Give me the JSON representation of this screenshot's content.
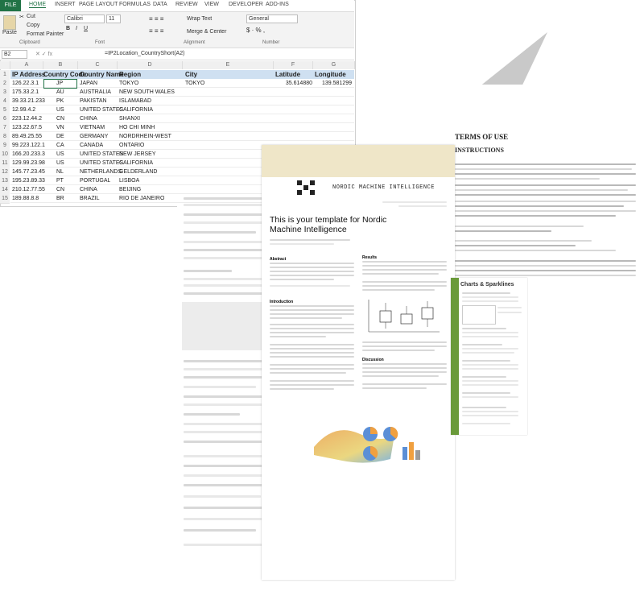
{
  "excel": {
    "ribbon_tabs": [
      "FILE",
      "HOME",
      "INSERT",
      "PAGE LAYOUT",
      "FORMULAS",
      "DATA",
      "REVIEW",
      "VIEW",
      "DEVELOPER",
      "ADD-INS"
    ],
    "clipboard": {
      "cut": "Cut",
      "copy": "Copy",
      "format_painter": "Format Painter",
      "paste": "Paste",
      "group": "Clipboard"
    },
    "font": {
      "name": "Calibri",
      "size": "11",
      "group": "Font"
    },
    "alignment": {
      "wrap": "Wrap Text",
      "merge": "Merge & Center",
      "group": "Alignment"
    },
    "number": {
      "format": "General",
      "group": "Number"
    },
    "name_box": "B2",
    "formula": "=IP2Location_CountryShort(A2)",
    "columns": [
      "A",
      "B",
      "C",
      "D",
      "E",
      "F",
      "G"
    ],
    "headers": [
      "IP Address",
      "Country Code",
      "Country Name",
      "Region",
      "City",
      "Latitude",
      "Longitude"
    ],
    "rows": [
      {
        "n": "2",
        "ip": "126.22.3.1",
        "cc": "JP",
        "country": "JAPAN",
        "region": "TOKYO",
        "city": "TOKYO",
        "lat": "35.614880",
        "lon": "139.581299"
      },
      {
        "n": "3",
        "ip": "175.33.2.1",
        "cc": "AU",
        "country": "AUSTRALIA",
        "region": "NEW SOUTH WALES",
        "city": "",
        "lat": "",
        "lon": ""
      },
      {
        "n": "4",
        "ip": "39.33.21.233",
        "cc": "PK",
        "country": "PAKISTAN",
        "region": "ISLAMABAD",
        "city": "",
        "lat": "",
        "lon": ""
      },
      {
        "n": "5",
        "ip": "12.99.4.2",
        "cc": "US",
        "country": "UNITED STATES",
        "region": "CALIFORNIA",
        "city": "",
        "lat": "",
        "lon": ""
      },
      {
        "n": "6",
        "ip": "223.12.44.2",
        "cc": "CN",
        "country": "CHINA",
        "region": "SHANXI",
        "city": "",
        "lat": "",
        "lon": ""
      },
      {
        "n": "7",
        "ip": "123.22.67.5",
        "cc": "VN",
        "country": "VIETNAM",
        "region": "HO CHI MINH",
        "city": "",
        "lat": "",
        "lon": ""
      },
      {
        "n": "8",
        "ip": "89.49.25.55",
        "cc": "DE",
        "country": "GERMANY",
        "region": "NORDRHEIN-WEST",
        "city": "",
        "lat": "",
        "lon": ""
      },
      {
        "n": "9",
        "ip": "99.223.122.1",
        "cc": "CA",
        "country": "CANADA",
        "region": "ONTARIO",
        "city": "",
        "lat": "",
        "lon": ""
      },
      {
        "n": "10",
        "ip": "166.20.233.3",
        "cc": "US",
        "country": "UNITED STATES",
        "region": "NEW JERSEY",
        "city": "",
        "lat": "",
        "lon": ""
      },
      {
        "n": "11",
        "ip": "129.99.23.98",
        "cc": "US",
        "country": "UNITED STATES",
        "region": "CALIFORNIA",
        "city": "",
        "lat": "",
        "lon": ""
      },
      {
        "n": "12",
        "ip": "145.77.23.45",
        "cc": "NL",
        "country": "NETHERLANDS",
        "region": "GELDERLAND",
        "city": "",
        "lat": "",
        "lon": ""
      },
      {
        "n": "13",
        "ip": "195.23.89.33",
        "cc": "PT",
        "country": "PORTUGAL",
        "region": "LISBOA",
        "city": "",
        "lat": "",
        "lon": ""
      },
      {
        "n": "14",
        "ip": "210.12.77.55",
        "cc": "CN",
        "country": "CHINA",
        "region": "BEIJING",
        "city": "",
        "lat": "",
        "lon": ""
      },
      {
        "n": "15",
        "ip": "189.88.8.8",
        "cc": "BR",
        "country": "BRAZIL",
        "region": "RIO DE JANEIRO",
        "city": "",
        "lat": "",
        "lon": ""
      }
    ]
  },
  "nordic": {
    "banner": "NORDIC MACHINE INTELLIGENCE",
    "title": "This is your template for Nordic Machine Intelligence",
    "sec_abstract": "Abstract",
    "sec_intro": "Introduction",
    "sec_results": "Results",
    "sec_discussion": "Discussion"
  },
  "terms": {
    "title": "TERMS OF USE",
    "subtitle": "INSTRUCTIONS"
  },
  "charts": {
    "title": "Charts & Sparklines"
  },
  "colors": {
    "excel_green": "#217346",
    "header_blue": "#cfe0f1",
    "banner": "#efe6c8"
  }
}
